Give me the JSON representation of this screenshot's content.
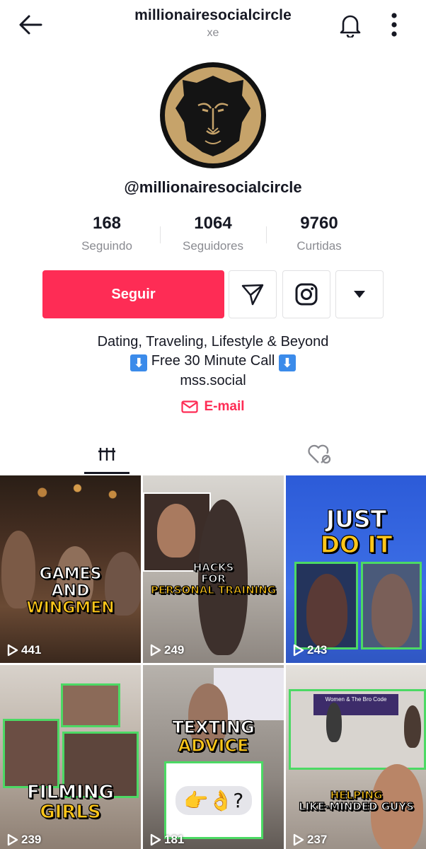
{
  "header": {
    "title": "millionairesocialcircle",
    "subtitle": "xe"
  },
  "profile": {
    "handle": "@millionairesocialcircle",
    "stats": [
      {
        "value": "168",
        "label": "Seguindo"
      },
      {
        "value": "1064",
        "label": "Seguidores"
      },
      {
        "value": "9760",
        "label": "Curtidas"
      }
    ],
    "follow_label": "Seguir",
    "bio_line1": "Dating, Traveling, Lifestyle & Beyond",
    "bio_line2": "Free 30 Minute Call",
    "bio_arrow": "⬇",
    "bio_line3": "mss.social",
    "email_label": "E-mail"
  },
  "colors": {
    "accent": "#fe2c55",
    "gold": "#c6a36a",
    "caption_yellow": "#ffc61a",
    "frame_green": "#4cd964"
  },
  "icons": [
    "back-arrow-icon",
    "bell-icon",
    "more-vertical-icon",
    "send-icon",
    "instagram-icon",
    "chevron-down-icon",
    "mail-icon",
    "grid-icon",
    "liked-lock-icon",
    "play-icon"
  ],
  "videos": [
    {
      "caption_line1": "GAMES",
      "caption_line2": "AND",
      "caption_line3": "WINGMEN",
      "views": "441"
    },
    {
      "caption_line1": "HACKS",
      "caption_line2": "FOR",
      "caption_line3": "PERSONAL TRAINING",
      "views": "249"
    },
    {
      "caption_line1": "JUST",
      "caption_line2": "DO IT",
      "views": "243"
    },
    {
      "caption_line1": "FILMING",
      "caption_line2": "GIRLS",
      "views": "239"
    },
    {
      "caption_line1": "TEXTING",
      "caption_line2": "ADVICE",
      "emoji": "👉👌?",
      "views": "181"
    },
    {
      "caption_line1": "HELPING",
      "caption_line2": "LIKE-MINDED GUYS",
      "screen_text": "Women & The Bro Code",
      "views": "237"
    }
  ]
}
